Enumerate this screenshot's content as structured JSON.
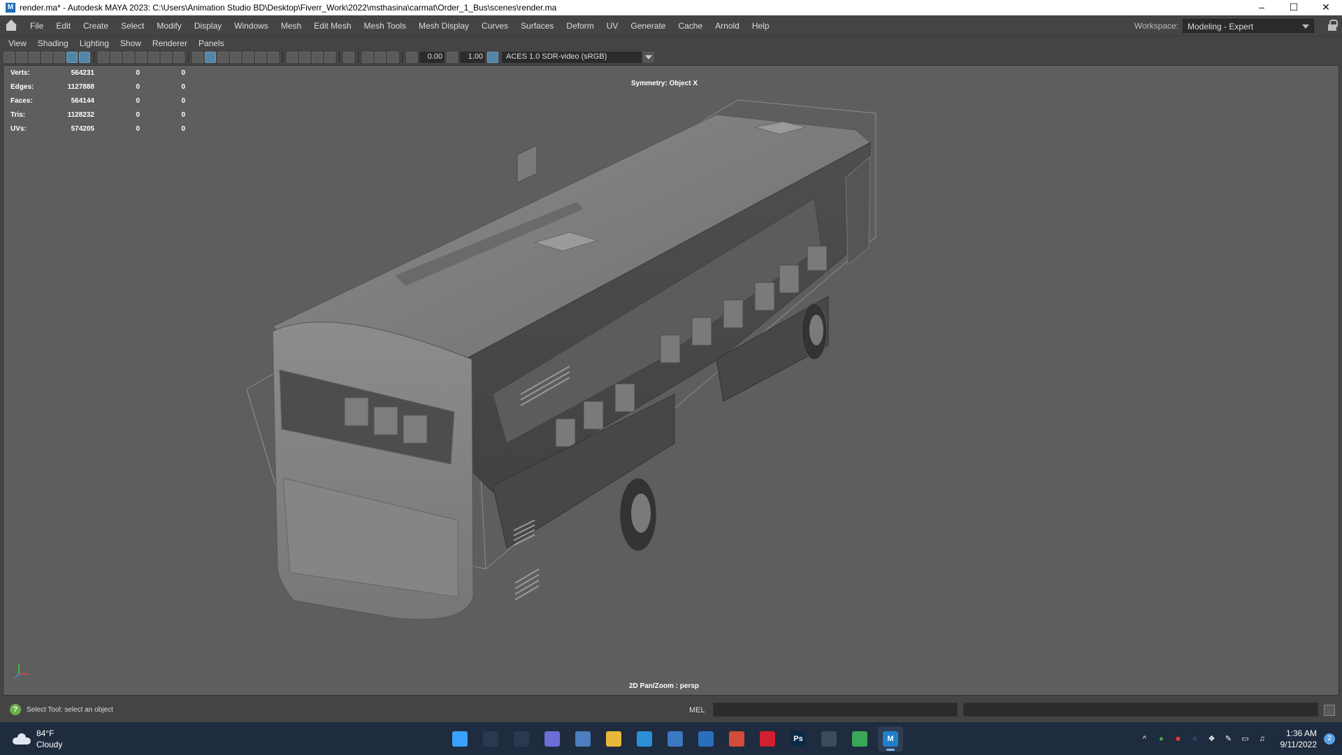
{
  "window": {
    "title": "render.ma* - Autodesk MAYA 2023: C:\\Users\\Animation Studio BD\\Desktop\\Fiverr_Work\\2022\\msthasina\\carmat\\Order_1_Bus\\scenes\\render.ma",
    "app_icon_letter": "M"
  },
  "menubar": {
    "items": [
      "File",
      "Edit",
      "Create",
      "Select",
      "Modify",
      "Display",
      "Windows",
      "Mesh",
      "Edit Mesh",
      "Mesh Tools",
      "Mesh Display",
      "Curves",
      "Surfaces",
      "Deform",
      "UV",
      "Generate",
      "Cache",
      "Arnold",
      "Help"
    ],
    "workspace_label": "Workspace:",
    "workspace_value": "Modeling - Expert"
  },
  "panel_menu": {
    "items": [
      "View",
      "Shading",
      "Lighting",
      "Show",
      "Renderer",
      "Panels"
    ]
  },
  "panel_toolbar": {
    "exposure": "0.00",
    "gamma": "1.00",
    "color_space": "ACES 1.0 SDR-video (sRGB)"
  },
  "hud": {
    "rows": [
      {
        "label": "Verts:",
        "v1": "564231",
        "v2": "0",
        "v3": "0"
      },
      {
        "label": "Edges:",
        "v1": "1127888",
        "v2": "0",
        "v3": "0"
      },
      {
        "label": "Faces:",
        "v1": "564144",
        "v2": "0",
        "v3": "0"
      },
      {
        "label": "Tris:",
        "v1": "1128232",
        "v2": "0",
        "v3": "0"
      },
      {
        "label": "UVs:",
        "v1": "574205",
        "v2": "0",
        "v3": "0"
      }
    ],
    "symmetry": "Symmetry: Object X",
    "camera": "2D Pan/Zoom : persp"
  },
  "statusbar": {
    "help_text": "Select Tool: select an object",
    "mel_label": "MEL"
  },
  "taskbar": {
    "weather_temp": "84°F",
    "weather_desc": "Cloudy",
    "apps": [
      {
        "name": "windows-start",
        "label": "",
        "color": "#3aa0ff"
      },
      {
        "name": "search",
        "label": "",
        "color": "#2a3850"
      },
      {
        "name": "task-view",
        "label": "",
        "color": "#2a3850"
      },
      {
        "name": "teams-chat",
        "label": "",
        "color": "#6b6ed6"
      },
      {
        "name": "photos",
        "label": "",
        "color": "#4b7fbf"
      },
      {
        "name": "file-explorer",
        "label": "",
        "color": "#e8b838"
      },
      {
        "name": "edge",
        "label": "",
        "color": "#2b8fd6"
      },
      {
        "name": "store",
        "label": "",
        "color": "#3a78c0"
      },
      {
        "name": "cortana",
        "label": "",
        "color": "#2a6fbd"
      },
      {
        "name": "chrome",
        "label": "",
        "color": "#d24b3b"
      },
      {
        "name": "opera",
        "label": "",
        "color": "#d3202f"
      },
      {
        "name": "photoshop",
        "label": "Ps",
        "color": "#0d2a47"
      },
      {
        "name": "calculator",
        "label": "",
        "color": "#3c4a5e"
      },
      {
        "name": "chrome-2",
        "label": "",
        "color": "#3aa657"
      },
      {
        "name": "maya",
        "label": "M",
        "color": "#1f7fc8"
      }
    ],
    "time": "1:36 AM",
    "date": "9/11/2022",
    "notification_count": "2"
  }
}
